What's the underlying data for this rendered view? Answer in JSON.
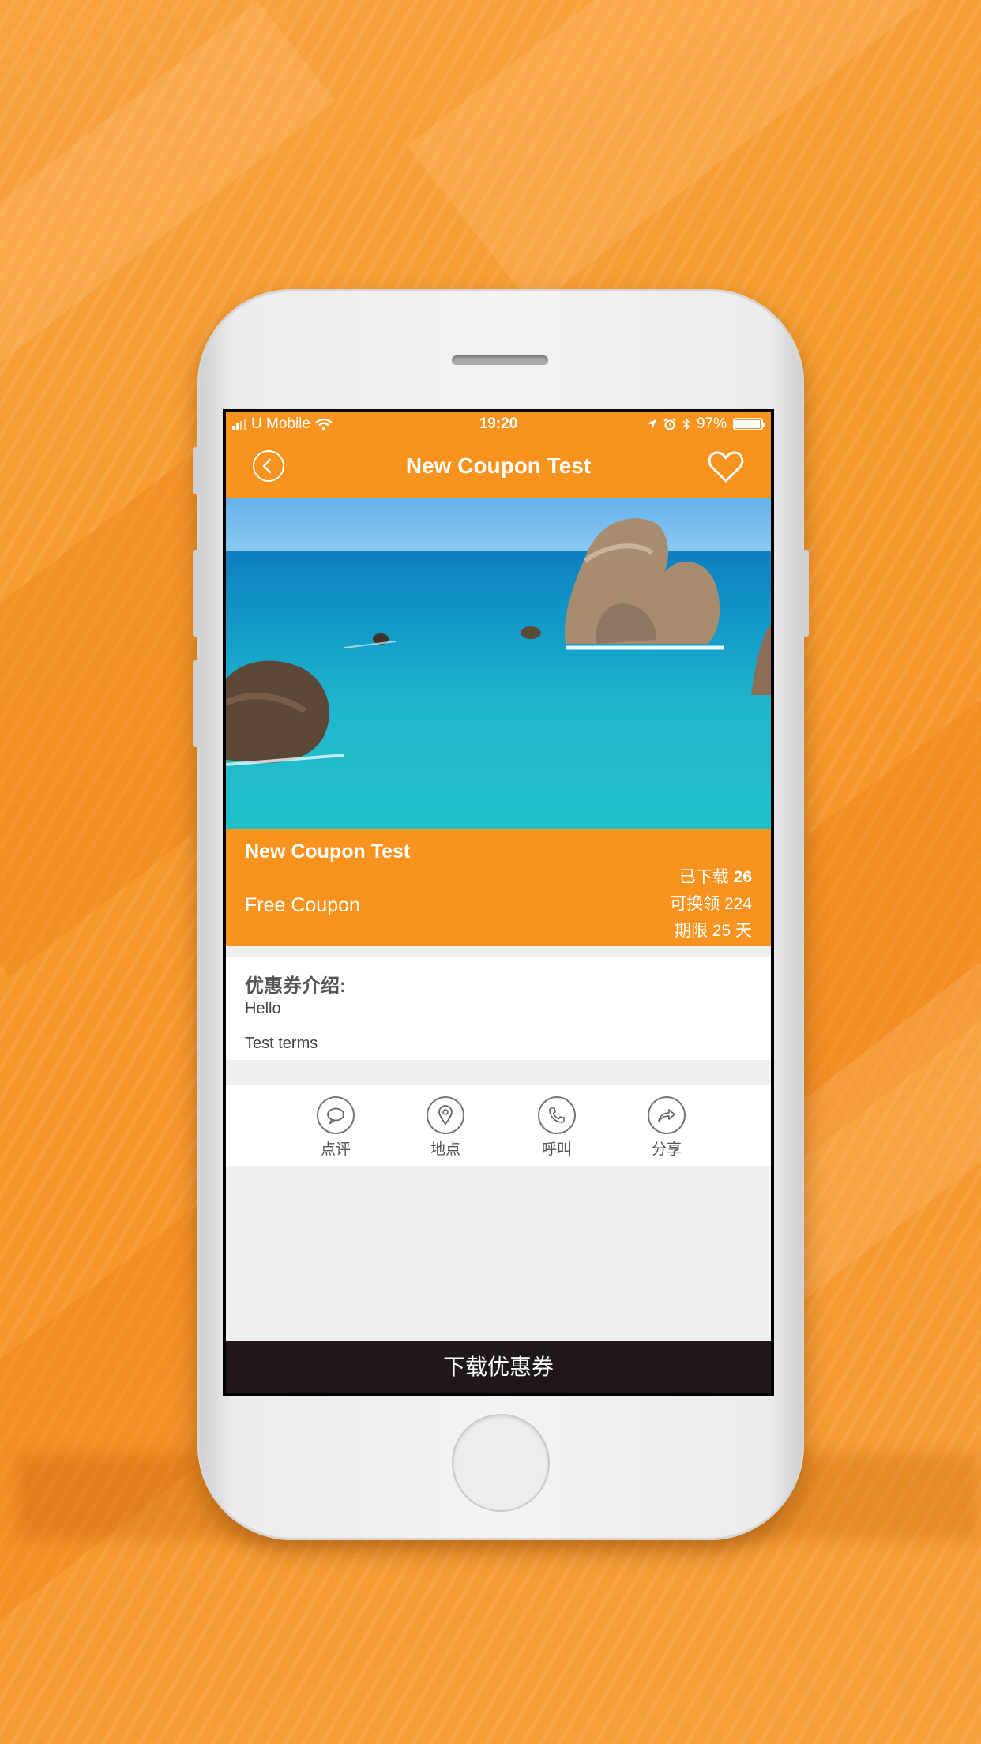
{
  "status_bar": {
    "carrier": "U Mobile",
    "time": "19:20",
    "battery": "97%",
    "battery_level": 0.97
  },
  "navbar": {
    "title": "New Coupon Test",
    "back_icon": "back-chevron-icon",
    "favorite_icon": "heart-icon"
  },
  "coupon": {
    "name": "New Coupon Test",
    "type": "Free Coupon",
    "downloaded_label": "已下载",
    "downloaded_count": "26",
    "redeemable": "可换领 224",
    "validity": "期限 25 天"
  },
  "description": {
    "heading": "优惠券介绍:",
    "body": "Hello",
    "terms": "Test terms"
  },
  "actions": [
    {
      "label": "点评",
      "icon": "comment-icon"
    },
    {
      "label": "地点",
      "icon": "location-icon"
    },
    {
      "label": "呼叫",
      "icon": "phone-icon"
    },
    {
      "label": "分享",
      "icon": "share-icon"
    }
  ],
  "download_button": "下载优惠券",
  "colors": {
    "accent": "#f7931e",
    "bottom_button": "#201718",
    "background": "#efefef"
  }
}
